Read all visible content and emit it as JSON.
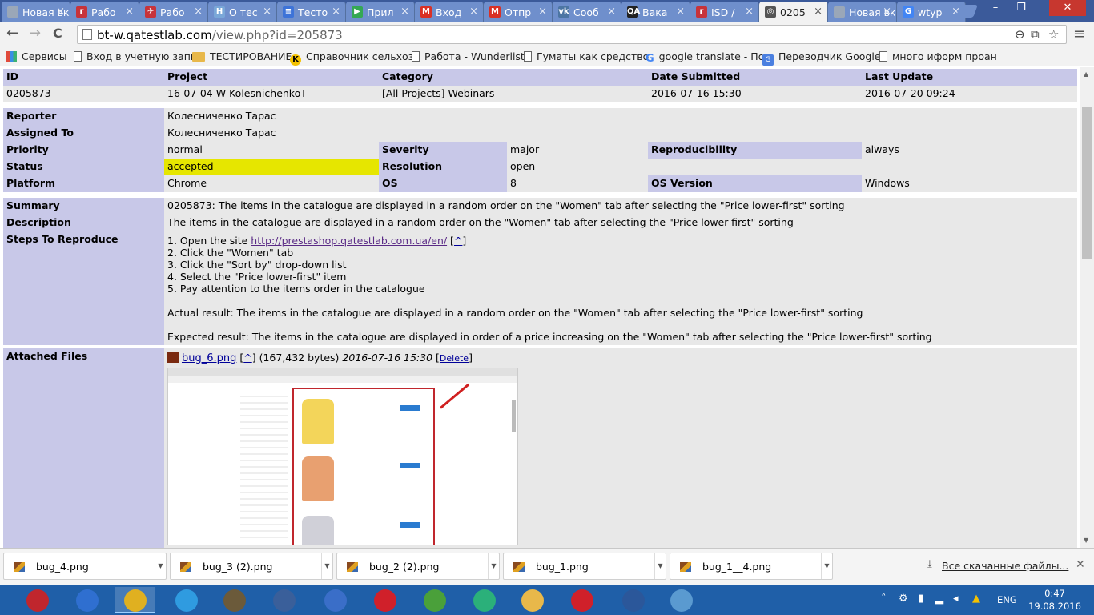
{
  "browser": {
    "tabs": [
      {
        "label": "Новая вкла",
        "icon_color": "#9aa7b8",
        "icon_text": ""
      },
      {
        "label": "Рабо",
        "icon_color": "#c7333a",
        "icon_text": "r"
      },
      {
        "label": "Рабо",
        "icon_color": "#c7333a",
        "icon_text": "✈"
      },
      {
        "label": "О тес",
        "icon_color": "#7aa7d8",
        "icon_text": "H"
      },
      {
        "label": "Тесто",
        "icon_color": "#3d73d8",
        "icon_text": "≡"
      },
      {
        "label": "Прил",
        "icon_color": "#34a853",
        "icon_text": "▶"
      },
      {
        "label": "Вход",
        "icon_color": "#d93025",
        "icon_text": "M"
      },
      {
        "label": "Отпр",
        "icon_color": "#d93025",
        "icon_text": "M"
      },
      {
        "label": "Сооб",
        "icon_color": "#4c75a3",
        "icon_text": "vk"
      },
      {
        "label": "Вака",
        "icon_color": "#222222",
        "icon_text": "QA"
      },
      {
        "label": "ISD /",
        "icon_color": "#c7333a",
        "icon_text": "r"
      },
      {
        "label": "0205",
        "icon_color": "#555555",
        "icon_text": "◎",
        "active": true
      },
      {
        "label": "Новая вк",
        "icon_color": "#9aa7b8",
        "icon_text": ""
      },
      {
        "label": "wtyp",
        "icon_color": "#4285f4",
        "icon_text": "G"
      }
    ],
    "window_controls": {
      "minimize": "–",
      "restore": "❐",
      "close": "✕"
    },
    "back_icon": "←",
    "forward_icon": "→",
    "reload_icon": "C",
    "url_host": "bt-w.qatestlab.com",
    "url_rest": "/view.php?id=205873",
    "omnibox_icons": {
      "zoom": "⊖",
      "translate": "⧉",
      "star": "☆"
    },
    "menu_icon": "≡",
    "bookmarks": [
      {
        "label": "Сервисы",
        "icon": "apps"
      },
      {
        "label": "Вход в учетную запи",
        "icon": "doc"
      },
      {
        "label": "ТЕСТИРОВАНИЕ",
        "icon": "folder"
      },
      {
        "label": "Справочник сельхоз",
        "icon": "k"
      },
      {
        "label": "Работа - Wunderlist",
        "icon": "doc"
      },
      {
        "label": "Гуматы как средство",
        "icon": "doc"
      },
      {
        "label": "google translate - По",
        "icon": "g"
      },
      {
        "label": "Переводчик Google",
        "icon": "gt"
      },
      {
        "label": "много иформ проан",
        "icon": "doc"
      }
    ]
  },
  "issue": {
    "header_labels": {
      "id": "ID",
      "project": "Project",
      "category": "Category",
      "date_submitted": "Date Submitted",
      "last_update": "Last Update"
    },
    "header_values": {
      "id": "0205873",
      "project": "16-07-04-W-KolesnichenkoT",
      "category": "[All Projects] Webinars",
      "date_submitted": "2016-07-16 15:30",
      "last_update": "2016-07-20 09:24"
    },
    "labels": {
      "reporter": "Reporter",
      "assigned_to": "Assigned To",
      "priority": "Priority",
      "severity": "Severity",
      "reproducibility": "Reproducibility",
      "status": "Status",
      "resolution": "Resolution",
      "platform": "Platform",
      "os": "OS",
      "os_version": "OS Version",
      "summary": "Summary",
      "description": "Description",
      "steps": "Steps To Reproduce",
      "attached_files": "Attached Files"
    },
    "values": {
      "reporter": "Колесниченко Тарас",
      "assigned_to": "Колесниченко Тарас",
      "priority": "normal",
      "severity": "major",
      "reproducibility": "always",
      "status": "accepted",
      "resolution": "open",
      "platform": "Chrome",
      "os": "8",
      "os_version": "Windows",
      "summary": "0205873: The items in the catalogue are displayed in a random order on the \"Women\" tab after selecting the \"Price lower-first\" sorting",
      "description": "The items in the catalogue are displayed in a random order on the \"Women\" tab after selecting the \"Price lower-first\" sorting"
    },
    "status_color": "#e6e600",
    "steps": {
      "step1_prefix": "1. Open the site ",
      "step1_link": "http://prestashop.qatestlab.com.ua/en/",
      "step1_suffix_link": "^",
      "lines": [
        "2. Click the \"Women\" tab",
        "3. Click the \"Sort by\" drop-down list",
        "4. Select the \"Price lower-first\" item",
        "5. Pay attention to the items order in the catalogue"
      ],
      "actual": "Actual result: The items in the catalogue are displayed in a random order on the \"Women\" tab after selecting the \"Price lower-first\" sorting",
      "expected": "Expected result: The items in the catalogue are displayed in order of a price increasing on the \"Women\" tab after selecting the \"Price lower-first\" sorting"
    },
    "attachment": {
      "file_name": "bug_6.png",
      "caret_link": "^",
      "size": "(167,432 bytes)",
      "date": "2016-07-16 15:30",
      "delete_label": "Delete"
    }
  },
  "downloads": {
    "items": [
      "bug_4.png",
      "bug_3 (2).png",
      "bug_2 (2).png",
      "bug_1.png",
      "bug_1__4.png"
    ],
    "all_downloads_label": "Все скачанные файлы...",
    "close_icon": "✕"
  },
  "taskbar": {
    "apps": [
      {
        "name": "power-app-icon",
        "color": "#c0262d"
      },
      {
        "name": "calculator-app-icon",
        "color": "#2f6fd0"
      },
      {
        "name": "chrome-app-icon",
        "color": "#e0b020",
        "active": true
      },
      {
        "name": "internet-explorer-icon",
        "color": "#2f9be0"
      },
      {
        "name": "speaker-app-icon",
        "color": "#6b5a3a"
      },
      {
        "name": "tool-app-icon",
        "color": "#3a5f9a"
      },
      {
        "name": "thunderbird-icon",
        "color": "#3a6ec8"
      },
      {
        "name": "opera-icon",
        "color": "#d0202a"
      },
      {
        "name": "utorrent-icon",
        "color": "#4aa03a"
      },
      {
        "name": "vpn-app-icon",
        "color": "#2bb07a"
      },
      {
        "name": "file-explorer-icon",
        "color": "#e8b84a"
      },
      {
        "name": "opera-icon-2",
        "color": "#d0202a"
      },
      {
        "name": "word-icon",
        "color": "#2b579a"
      },
      {
        "name": "photo-viewer-icon",
        "color": "#5a9ad0"
      }
    ],
    "language": "ENG",
    "time": "0:47",
    "date": "19.08.2016"
  }
}
